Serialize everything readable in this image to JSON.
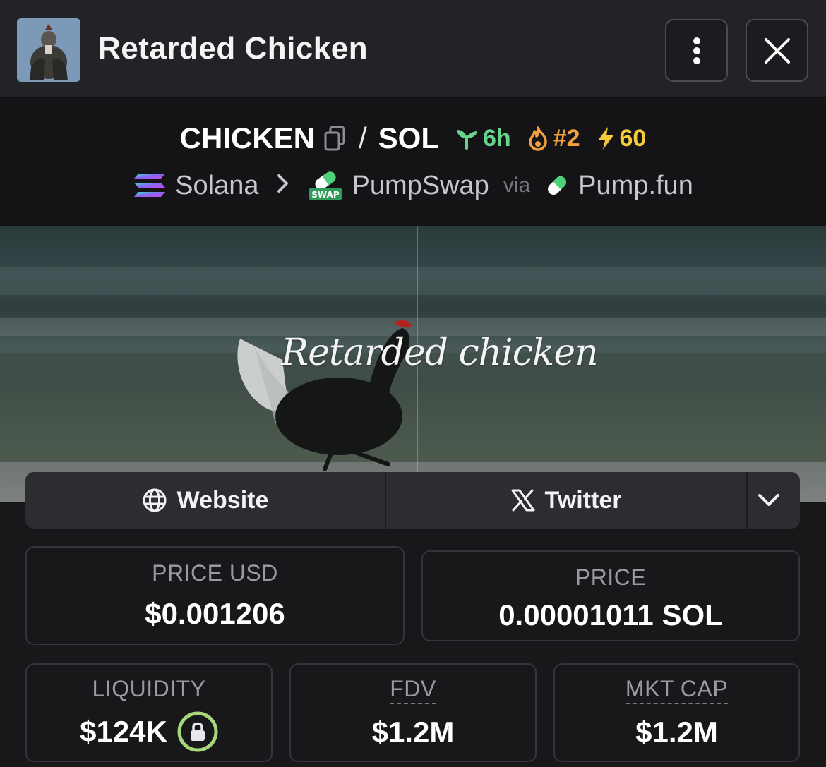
{
  "header": {
    "title": "Retarded Chicken",
    "more_icon": "more-vertical-icon",
    "close_icon": "close-icon"
  },
  "pair": {
    "base": "CHICKEN",
    "separator": "/",
    "quote": "SOL",
    "age": "6h",
    "trending_rank": "#2",
    "boosts": "60",
    "chain": "Solana",
    "dex": "PumpSwap",
    "via": "via",
    "launchpad": "Pump.fun",
    "dex_icon_text": "SWAP"
  },
  "banner": {
    "text": "Retarded chicken"
  },
  "links": {
    "website": "Website",
    "twitter": "Twitter"
  },
  "stats": {
    "price_usd_label": "PRICE USD",
    "price_usd_value": "$0.001206",
    "price_label": "PRICE",
    "price_value": "0.00001011 SOL",
    "liquidity_label": "LIQUIDITY",
    "liquidity_value": "$124K",
    "fdv_label": "FDV",
    "fdv_value": "$1.2M",
    "mktcap_label": "MKT CAP",
    "mktcap_value": "$1.2M"
  },
  "colors": {
    "age_green": "#67d48c",
    "rank_orange": "#f0a03c",
    "boost_yellow": "#f4cc3a",
    "lock_ring": "#a8d67a"
  }
}
